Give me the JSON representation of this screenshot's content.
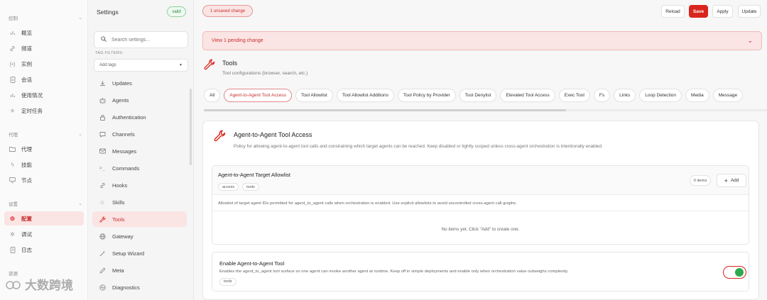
{
  "nav": {
    "section_control": "控制",
    "overview": "概览",
    "channels": "频道",
    "instances": "实例",
    "sessions": "会话",
    "usage": "使用情况",
    "cron": "定时任务",
    "section_agent": "代理",
    "agents": "代理",
    "skills": "技能",
    "nodes": "节点",
    "section_settings": "设置",
    "config": "配置",
    "debug": "调试",
    "logs": "日志",
    "section_resources": "资源"
  },
  "settings_panel": {
    "title": "Settings",
    "status_badge": "valid",
    "search_placeholder": "Search settings...",
    "tag_filters_label": "TAG FILTERS:",
    "tag_select_placeholder": "Add tags",
    "items": [
      {
        "label": "Updates",
        "icon": "download-icon"
      },
      {
        "label": "Agents",
        "icon": "bot-icon"
      },
      {
        "label": "Authentication",
        "icon": "lock-icon"
      },
      {
        "label": "Channels",
        "icon": "message-icon"
      },
      {
        "label": "Messages",
        "icon": "mail-icon"
      },
      {
        "label": "Commands",
        "icon": "terminal-icon"
      },
      {
        "label": "Hooks",
        "icon": "link-icon"
      },
      {
        "label": "Skills",
        "icon": "star-icon"
      },
      {
        "label": "Tools",
        "icon": "wrench-icon"
      },
      {
        "label": "Gateway",
        "icon": "globe-icon"
      },
      {
        "label": "Setup Wizard",
        "icon": "wand-icon"
      },
      {
        "label": "Meta",
        "icon": "pencil-icon"
      },
      {
        "label": "Diagnostics",
        "icon": "pulse-icon"
      }
    ]
  },
  "topbar": {
    "unsaved_badge": "1 unsaved change",
    "reload": "Reload",
    "save": "Save",
    "apply": "Apply",
    "update": "Update"
  },
  "pending_banner": "View 1 pending change",
  "section": {
    "title": "Tools",
    "description": "Tool configurations (browser, search, etc.)"
  },
  "tabs": [
    "All",
    "Agent-to-Agent Tool Access",
    "Tool Allowlist",
    "Tool Allowlist Additions",
    "Tool Policy by Provider",
    "Tool Denylist",
    "Elevated Tool Access",
    "Exec Tool",
    "Fs",
    "Links",
    "Loop Detection",
    "Media",
    "Message"
  ],
  "card": {
    "title": "Agent-to-Agent Tool Access",
    "description": "Policy for allowing agent-to-agent tool calls and constraining which target agents can be reached. Keep disabled or tightly scoped unless cross-agent orchestration is intentionally enabled.",
    "allowlist": {
      "title": "Agent-to-Agent Target Allowlist",
      "tags": [
        "access",
        "tools"
      ],
      "count": "0 items",
      "add_label": "Add",
      "description": "Allowlist of target agent IDs permitted for agent_to_agent calls when orchestration is enabled. Use explicit allowlists to avoid uncontrolled cross-agent call graphs.",
      "empty_text": "No items yet. Click \"Add\" to create one."
    },
    "enable": {
      "title": "Enable Agent-to-Agent Tool",
      "description": "Enables the agent_to_agent tool surface so one agent can invoke another agent at runtime. Keep off in simple deployments and enable only when orchestration value outweighs complexity.",
      "tag": "tools",
      "enabled": true
    }
  },
  "colors": {
    "accent": "#d9261c",
    "accent_soft": "#fbe4e4",
    "success": "#2fa84f"
  }
}
